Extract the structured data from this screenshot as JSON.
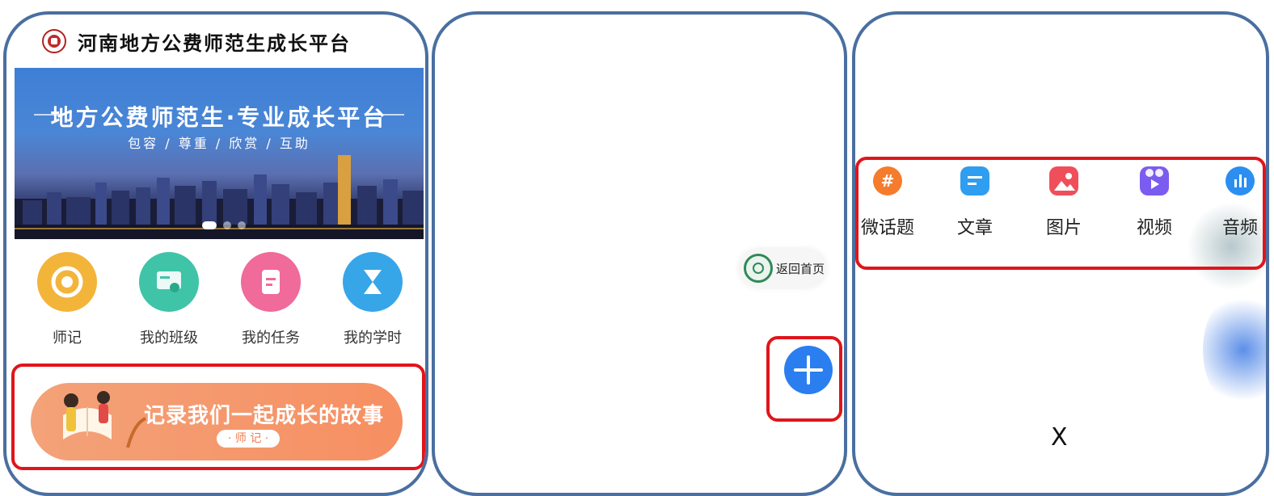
{
  "screen1": {
    "app_title": "河南地方公费师范生成长平台",
    "banner": {
      "title": "地方公费师范生·专业成长平台",
      "subtitle": "包容 / 尊重 / 欣赏 / 互助"
    },
    "menu": [
      {
        "label": "师记",
        "icon": "notes-icon",
        "color": "#f3b43a"
      },
      {
        "label": "我的班级",
        "icon": "class-icon",
        "color": "#3fc4a8"
      },
      {
        "label": "我的任务",
        "icon": "task-icon",
        "color": "#f06a9a"
      },
      {
        "label": "我的学时",
        "icon": "hourglass-icon",
        "color": "#36a6e8"
      }
    ],
    "story_banner": {
      "text": "记录我们一起成长的故事",
      "badge": "· 师 记 ·"
    }
  },
  "screen2": {
    "home_button": "返回首页",
    "fab_icon": "plus-icon"
  },
  "screen3": {
    "publish_options": [
      {
        "label": "微话题",
        "icon": "hashtag-icon",
        "color": "#f57c2c"
      },
      {
        "label": "文章",
        "icon": "article-icon",
        "color": "#2f9df0"
      },
      {
        "label": "图片",
        "icon": "image-icon",
        "color": "#ef4f5a"
      },
      {
        "label": "视频",
        "icon": "video-icon",
        "color": "#7b5cf0"
      },
      {
        "label": "音频",
        "icon": "audio-icon",
        "color": "#2b8ef0"
      }
    ],
    "close_label": "X"
  },
  "colors": {
    "frame": "#4a6fa0",
    "highlight": "#e0151b",
    "accent_blue": "#2b7ef0",
    "story_orange": "#f68f62"
  }
}
